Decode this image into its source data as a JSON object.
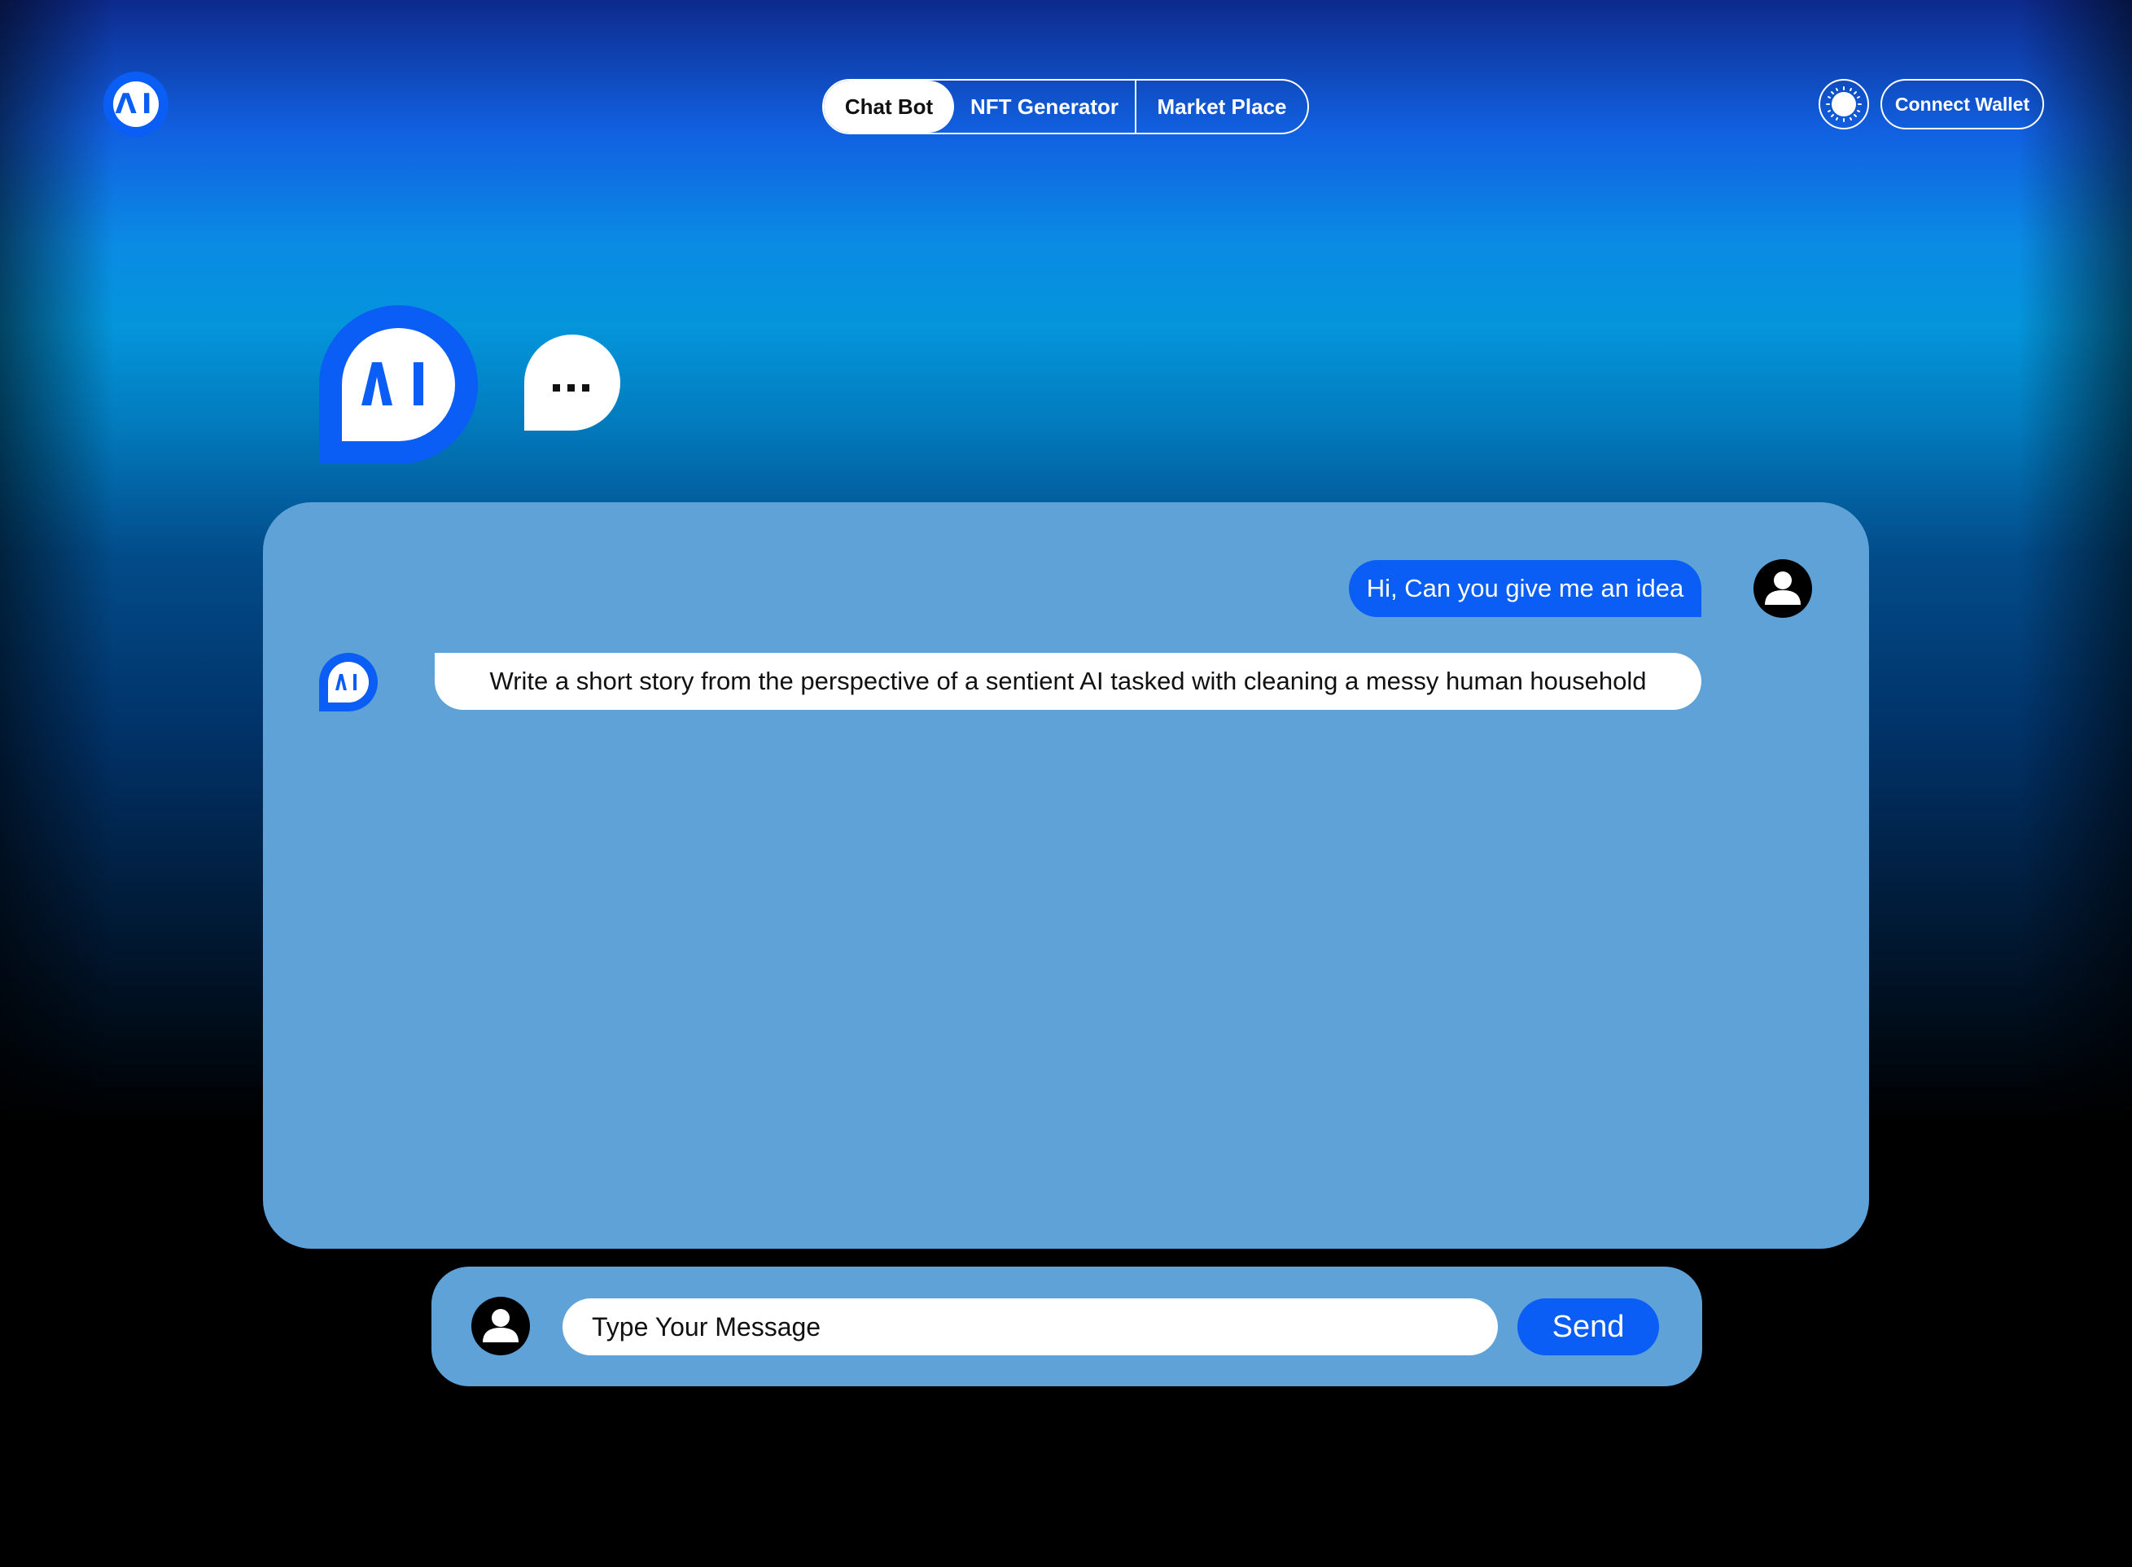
{
  "app": {
    "logo_text": "ΛI"
  },
  "nav": {
    "tabs": [
      {
        "label": "Chat Bot",
        "active": true
      },
      {
        "label": "NFT Generator",
        "active": false
      },
      {
        "label": "Market Place",
        "active": false
      }
    ]
  },
  "header": {
    "theme_icon": "sun-icon",
    "wallet_label": "Connect Wallet"
  },
  "chat": {
    "messages": [
      {
        "sender": "user",
        "text": "Hi, Can you give me an idea"
      },
      {
        "sender": "bot",
        "text": "Write a short story from the perspective of a sentient AI tasked with cleaning a messy human household"
      }
    ]
  },
  "composer": {
    "placeholder": "Type Your Message",
    "send_label": "Send"
  },
  "colors": {
    "accent": "#0a5ef5",
    "panel": "#5ea2d8"
  }
}
